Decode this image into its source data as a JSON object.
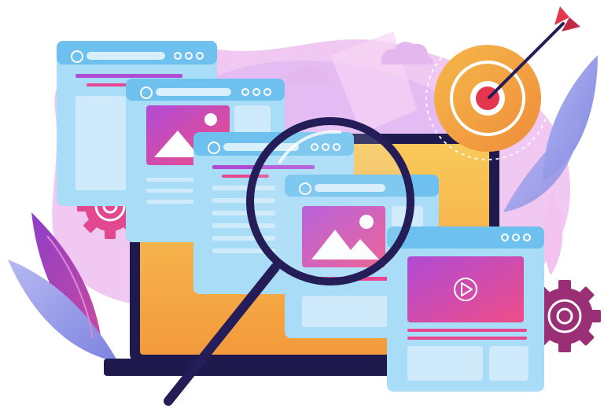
{
  "illustration": {
    "topic": "",
    "icons": [
      "magnifier-icon",
      "target-icon",
      "arrow-icon",
      "gear-icon",
      "image-icon",
      "play-icon",
      "cloud-icon",
      "laptop-icon",
      "browser-window-icon"
    ]
  },
  "colors": {
    "blob_pink": "#f3c9f1",
    "blob_lavender": "#e4bdf3",
    "window_blue": "#a9dcf7",
    "window_blue_dark": "#6ec1ee",
    "window_panel": "#cfeafb",
    "accent_purple": "#b04bd6",
    "accent_pink": "#e8478f",
    "target_orange": "#f3a93c",
    "target_red": "#e5364f",
    "laptop_dark": "#1f1a4d",
    "laptop_screen": "#f6b04a",
    "magnifier_ring": "#241d57"
  }
}
